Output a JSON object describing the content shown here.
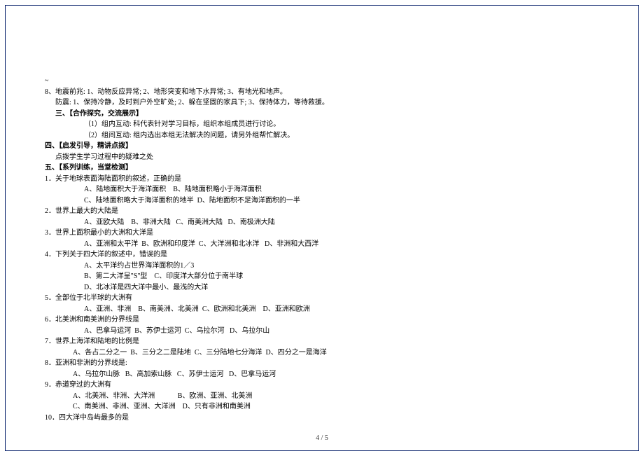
{
  "tilde": "~",
  "l8_1": "8、地震前兆: 1、动物反应异常; 2、地形突变和地下水异常; 3、有地光和地声。",
  "l8_2": "      防震: 1、保持冷静，及时到户外空旷处; 2、躲在坚固的家具下; 3、保持体力，等待救援。",
  "s3_h": "      三、【合作探究，交流展示】",
  "s3_1": "（1）组内互动: 科代表针对学习目标，组织本组成员进行讨论。",
  "s3_2": "（2）组间互动: 组内选出本组无法解决的问题，请另外组帮忙解决。",
  "s4_h": "四、【启发引导，精讲点拨】",
  "s4_1": "      点拨学生学习过程中的疑难之处",
  "s5_h": "五、【系列训练，当堂检测】",
  "q1": "1．关于地球表面海陆面积的叙述，正确的是",
  "q1a": "A、陆地面积大于海洋面积    B、陆地面积略小于海洋面积",
  "q1b": "C、陆地面积略大于海洋面积的地半  D、陆地面积不足海洋面积的一半",
  "q2": "2．世界上最大的大陆是",
  "q2a": "A、亚欧大陆    B、非洲大陆   C、南美洲大陆   D、南极洲大陆",
  "q3": "3．世界上面积最小的大洲和大洋是",
  "q3a": "A、亚洲和太平洋  B、欧洲和印度洋  C、大洋洲和北冰洋   D、非洲和大西洋",
  "q4": "4．下列关于四大洋的叙述中，错误的是",
  "q4a": "A、太平洋约占世界海洋面积的1／3",
  "q4b": "B、第二大洋呈\"S\"型    C、印度洋大部分位于南半球",
  "q4c": "D、北冰洋是四大洋中最小、最浅的大洋",
  "q5": "5．全部位于北半球的大洲有",
  "q5a": "A、亚洲、非洲    B、南美洲、北美洲  C、欧洲和北美洲    D、亚洲和欧洲",
  "q6": "6．北美洲和南美洲的分界线是",
  "q6a": "A、巴拿马运河  B、苏伊士运河  C、乌拉尔河   D、乌拉尔山",
  "q7": "7．世界上海洋和陆地的比例是",
  "q7a": "A、各占二分之一  B、三分之二是陆地  C、三分陆地七分海洋  D、四分之一是海洋",
  "q8": "8．亚洲和非洲的分界线是:",
  "q8a": "A、乌拉尔山脉   B、高加索山脉   C、苏伊士运河   D、巴拿马运河",
  "q9": "9．赤道穿过的大洲有",
  "q9a": "A、北美洲、非洲、大洋洲             B、欧洲、亚洲、北美洲",
  "q9b": "C、南美洲、非洲、亚洲、大洋洲    D、只有非洲和南美洲",
  "q10": "10．四大洋中岛屿最多的是",
  "footer": "4 / 5"
}
